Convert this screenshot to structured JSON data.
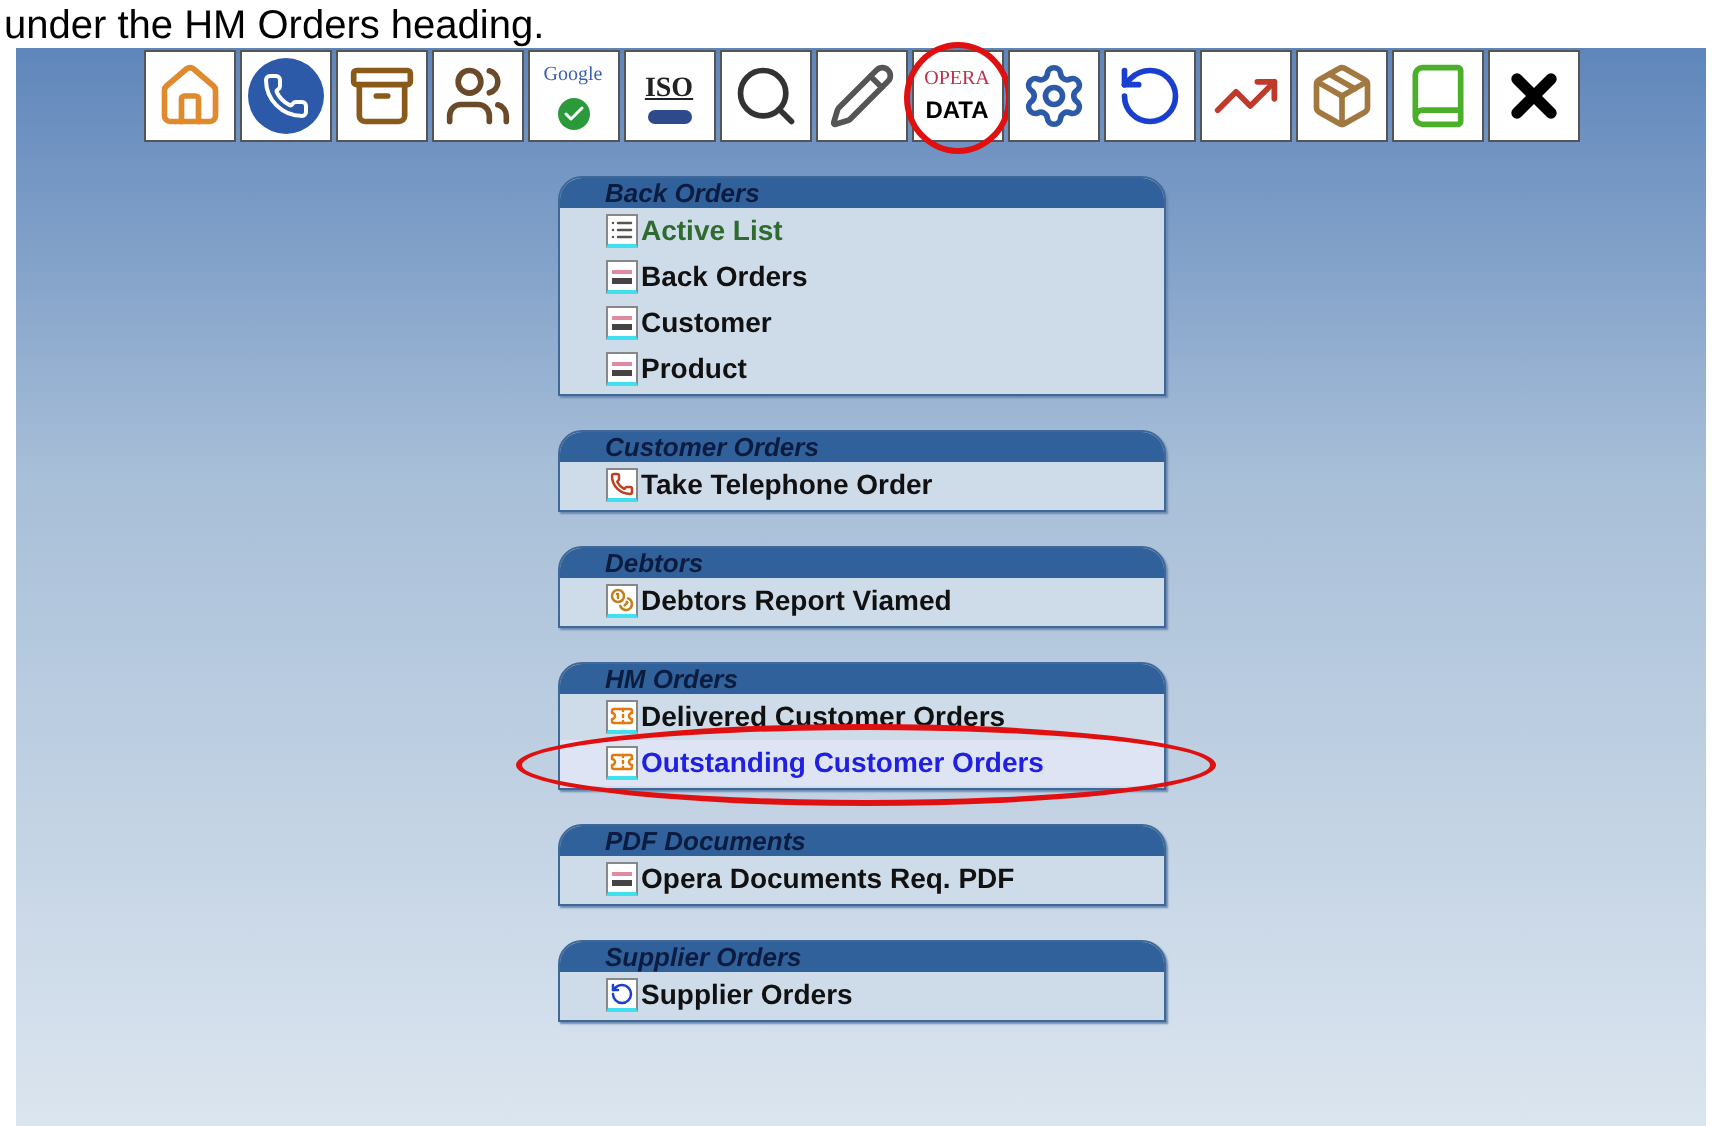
{
  "caption": "under the HM Orders heading.",
  "toolbar": [
    {
      "kind": "home",
      "circled": false
    },
    {
      "kind": "phone",
      "circled": false
    },
    {
      "kind": "chest",
      "circled": false
    },
    {
      "kind": "users",
      "circled": false
    },
    {
      "kind": "google",
      "text": "Google",
      "circled": false
    },
    {
      "kind": "iso",
      "text": "ISO",
      "circled": false
    },
    {
      "kind": "search",
      "circled": false
    },
    {
      "kind": "pencil",
      "circled": false
    },
    {
      "kind": "opera",
      "text": "OPERA",
      "text2": "DATA",
      "circled": true
    },
    {
      "kind": "gears",
      "circled": false
    },
    {
      "kind": "refresh",
      "circled": false
    },
    {
      "kind": "chart",
      "circled": false
    },
    {
      "kind": "box",
      "circled": false
    },
    {
      "kind": "book",
      "circled": false
    },
    {
      "kind": "close",
      "circled": false
    }
  ],
  "panels": [
    {
      "title": "Back Orders",
      "items": [
        {
          "label": "Active List",
          "kind": "list",
          "visited": true,
          "highlighted": false,
          "circled": false
        },
        {
          "label": "Back Orders",
          "kind": "opera",
          "visited": false,
          "highlighted": false,
          "circled": false
        },
        {
          "label": "Customer",
          "kind": "opera",
          "visited": false,
          "highlighted": false,
          "circled": false
        },
        {
          "label": "Product",
          "kind": "opera",
          "visited": false,
          "highlighted": false,
          "circled": false
        }
      ]
    },
    {
      "title": "Customer Orders",
      "items": [
        {
          "label": "Take Telephone Order",
          "kind": "phone",
          "visited": false,
          "highlighted": false,
          "circled": false
        }
      ]
    },
    {
      "title": "Debtors",
      "items": [
        {
          "label": "Debtors Report Viamed",
          "kind": "coins",
          "visited": false,
          "highlighted": false,
          "circled": false
        }
      ]
    },
    {
      "title": "HM Orders",
      "items": [
        {
          "label": "Delivered Customer Orders",
          "kind": "ticket",
          "visited": false,
          "highlighted": false,
          "circled": false
        },
        {
          "label": "Outstanding Customer Orders",
          "kind": "ticket",
          "visited": false,
          "highlighted": true,
          "circled": true
        }
      ]
    },
    {
      "title": "PDF Documents",
      "items": [
        {
          "label": "Opera Documents Req. PDF",
          "kind": "opera",
          "visited": false,
          "highlighted": false,
          "circled": false
        }
      ]
    },
    {
      "title": "Supplier Orders",
      "items": [
        {
          "label": "Supplier Orders",
          "kind": "refresh",
          "visited": false,
          "highlighted": false,
          "circled": false
        }
      ]
    }
  ]
}
